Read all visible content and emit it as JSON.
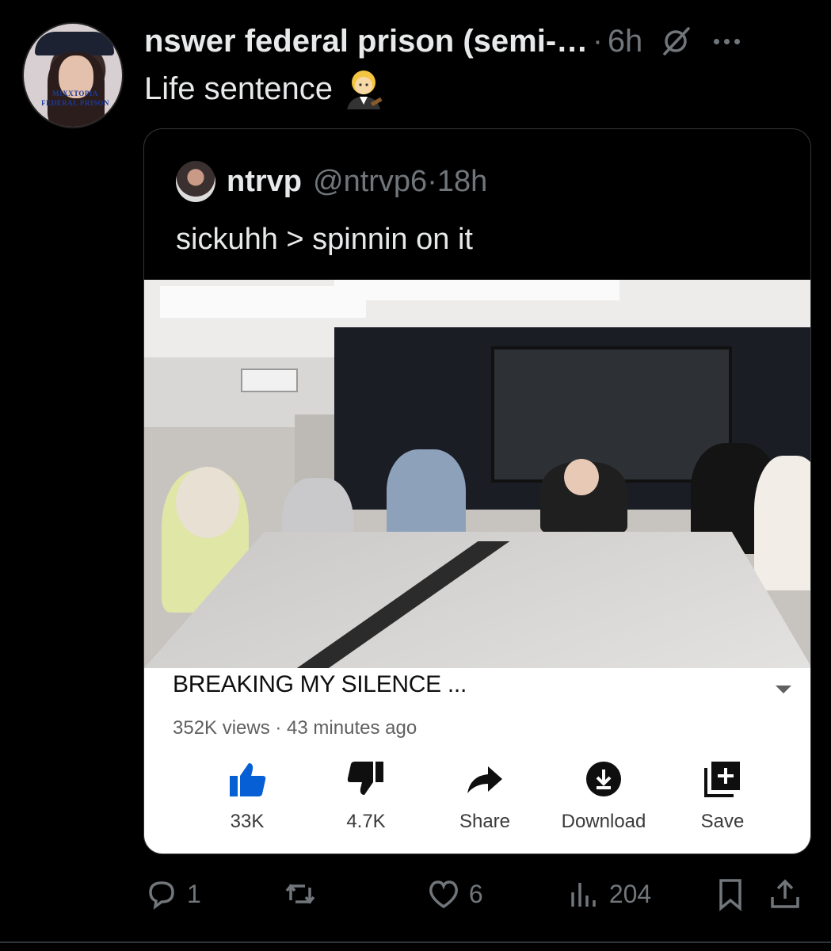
{
  "post": {
    "display_name": "nswer federal prison (semi-…",
    "separator": "·",
    "time": "6h",
    "text": "Life sentence",
    "avatar_stamp": "MIXXTOPIA FEDERAL PRISON",
    "icons": {
      "null": "grok-null-icon",
      "more": "more-icon",
      "emoji": "woman-judge-emoji"
    }
  },
  "quote": {
    "name": "ntrvp",
    "handle": "@ntrvp6",
    "separator": "·",
    "time": "18h",
    "text": "sickuhh > spinnin on it"
  },
  "video": {
    "title": "BREAKING MY SILENCE ...",
    "meta": "352K views · 43 minutes ago",
    "actions": [
      {
        "label": "33K",
        "icon": "thumbs-up-icon"
      },
      {
        "label": "4.7K",
        "icon": "thumbs-down-icon"
      },
      {
        "label": "Share",
        "icon": "share-arrow-icon"
      },
      {
        "label": "Download",
        "icon": "download-icon"
      },
      {
        "label": "Save",
        "icon": "save-playlist-icon"
      }
    ]
  },
  "engagement": {
    "replies": "1",
    "reposts": "",
    "likes": "6",
    "views": "204"
  },
  "colors": {
    "accent": "#065fd4",
    "muted": "#71767b",
    "text": "#e7e9ea"
  }
}
